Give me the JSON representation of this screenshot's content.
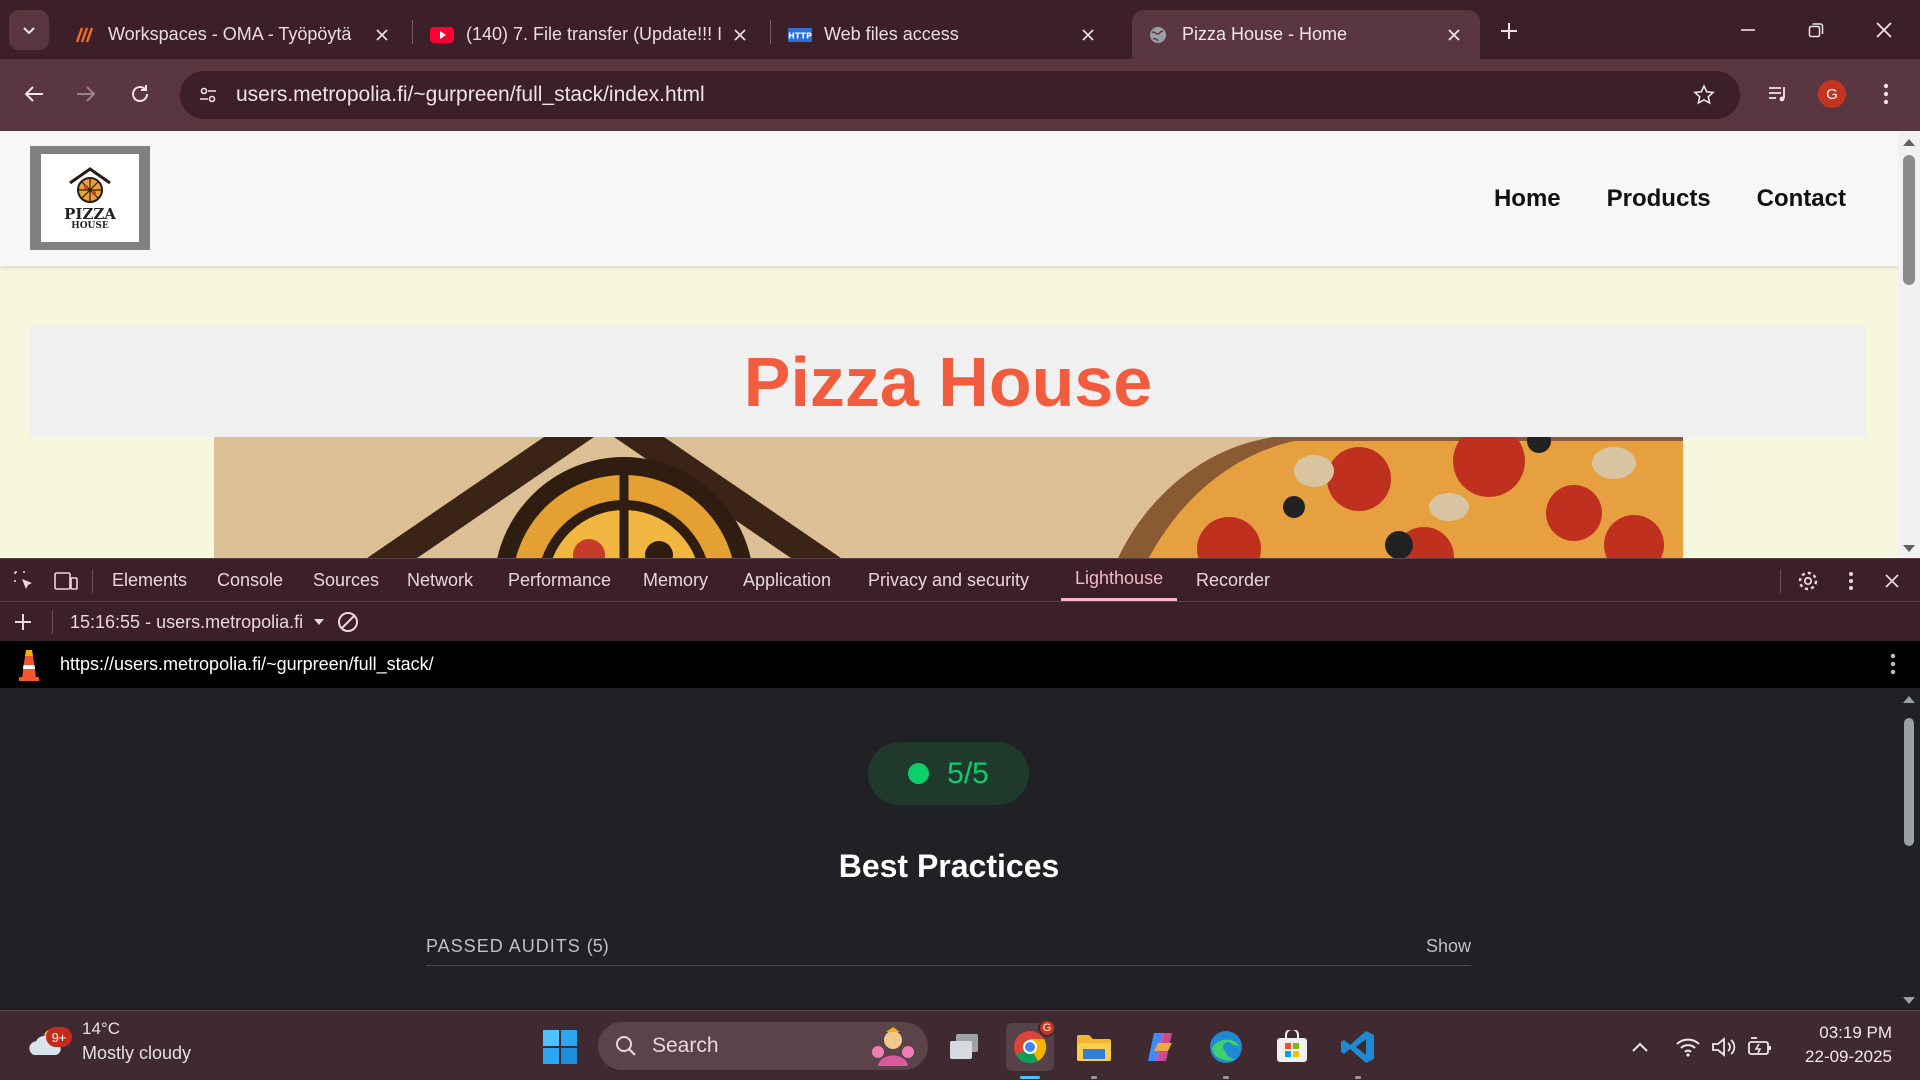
{
  "browser": {
    "tabs": [
      {
        "title": "Workspaces - OMA - Työpöytä",
        "icon": "oma-icon"
      },
      {
        "title": "(140) 7. File transfer (Update!!! I",
        "icon": "youtube-icon"
      },
      {
        "title": "Web files access",
        "icon": "http-icon"
      },
      {
        "title": "Pizza House - Home",
        "icon": "globe-icon",
        "active": true
      }
    ],
    "url": "users.metropolia.fi/~gurpreen/full_stack/index.html",
    "profile_initial": "G"
  },
  "site": {
    "logo_text": "PIZZA",
    "logo_sub": "HOUSE",
    "nav": [
      "Home",
      "Products",
      "Contact"
    ],
    "hero_title": "Pizza House"
  },
  "devtools": {
    "tabs": [
      "Elements",
      "Console",
      "Sources",
      "Network",
      "Performance",
      "Memory",
      "Application",
      "Privacy and security",
      "Lighthouse",
      "Recorder"
    ],
    "active_tab": "Lighthouse",
    "report_select": "15:16:55 - users.metropolia.fi",
    "lighthouse_url": "https://users.metropolia.fi/~gurpreen/full_stack/",
    "score": "5/5",
    "category_title": "Best Practices",
    "passed_label": "PASSED AUDITS",
    "passed_count": "(5)",
    "show_label": "Show"
  },
  "taskbar": {
    "weather_temp": "14°C",
    "weather_desc": "Mostly cloudy",
    "weather_badge": "9+",
    "search_label": "Search",
    "time": "03:19 PM",
    "date": "22-09-2025"
  },
  "colors": {
    "chrome_frame": "#3c1f28",
    "toolbar": "#5a3640",
    "hero_title": "#f25c3e",
    "page_bg": "#f7f7dd",
    "score_green": "#0cce6b",
    "devtools_active": "#f6b8c8"
  }
}
